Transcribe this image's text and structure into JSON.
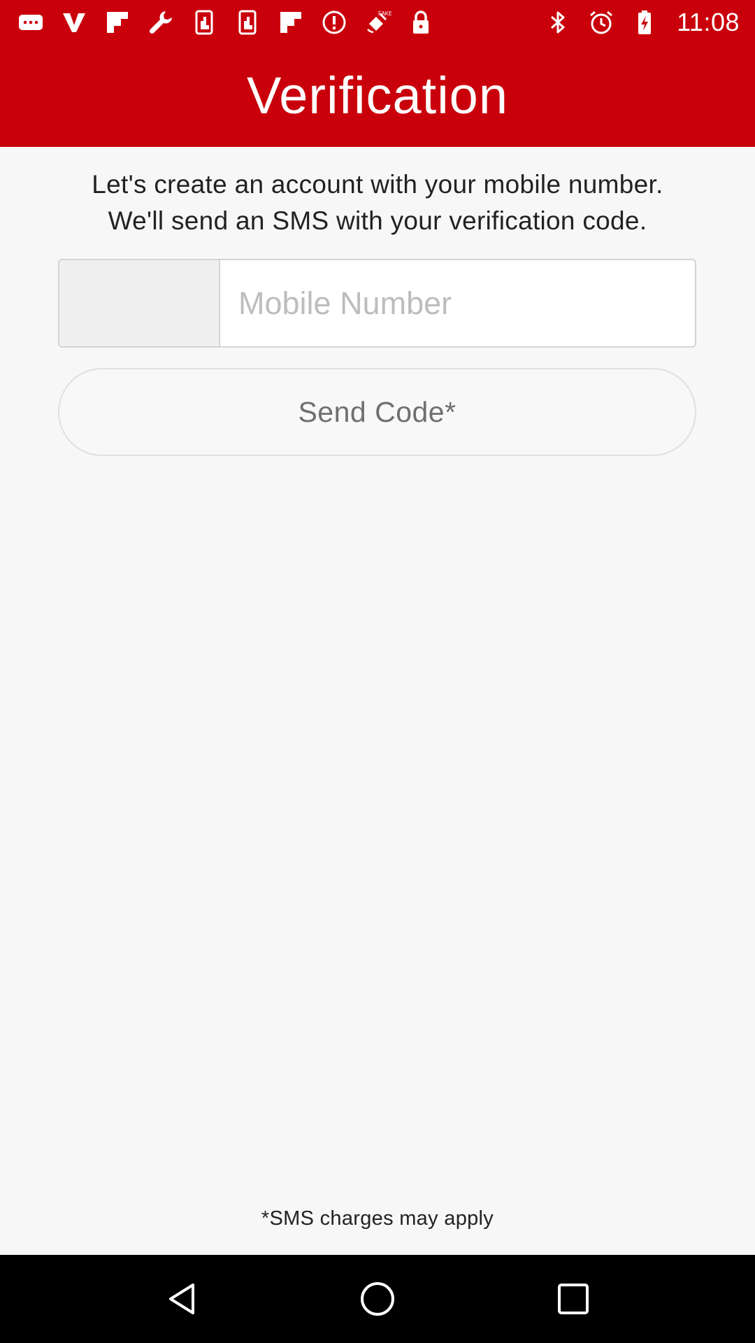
{
  "status_bar": {
    "left_icons": [
      "chat-bubble-icon",
      "v-logo-icon",
      "flipboard-icon",
      "wrench-icon",
      "phone-hand-icon",
      "phone-hand-icon",
      "flipboard-icon",
      "alert-circle-icon",
      "satellite-icon",
      "lock-icon"
    ],
    "right_icons": [
      "bluetooth-icon",
      "alarm-icon",
      "battery-charging-icon"
    ],
    "time": "11:08",
    "fake_label": "FAKE"
  },
  "header": {
    "title": "Verification",
    "background_color": "#c9000b"
  },
  "intro": {
    "line1": "Let's create an account with your mobile number.",
    "line2": "We'll send an SMS with your verification code."
  },
  "phone_input": {
    "placeholder": "Mobile Number",
    "value": ""
  },
  "send_button": {
    "label": "Send Code*"
  },
  "footer": {
    "note": "*SMS charges may apply"
  },
  "nav_bar": {
    "buttons": [
      "back-icon",
      "home-icon",
      "recents-icon"
    ]
  }
}
